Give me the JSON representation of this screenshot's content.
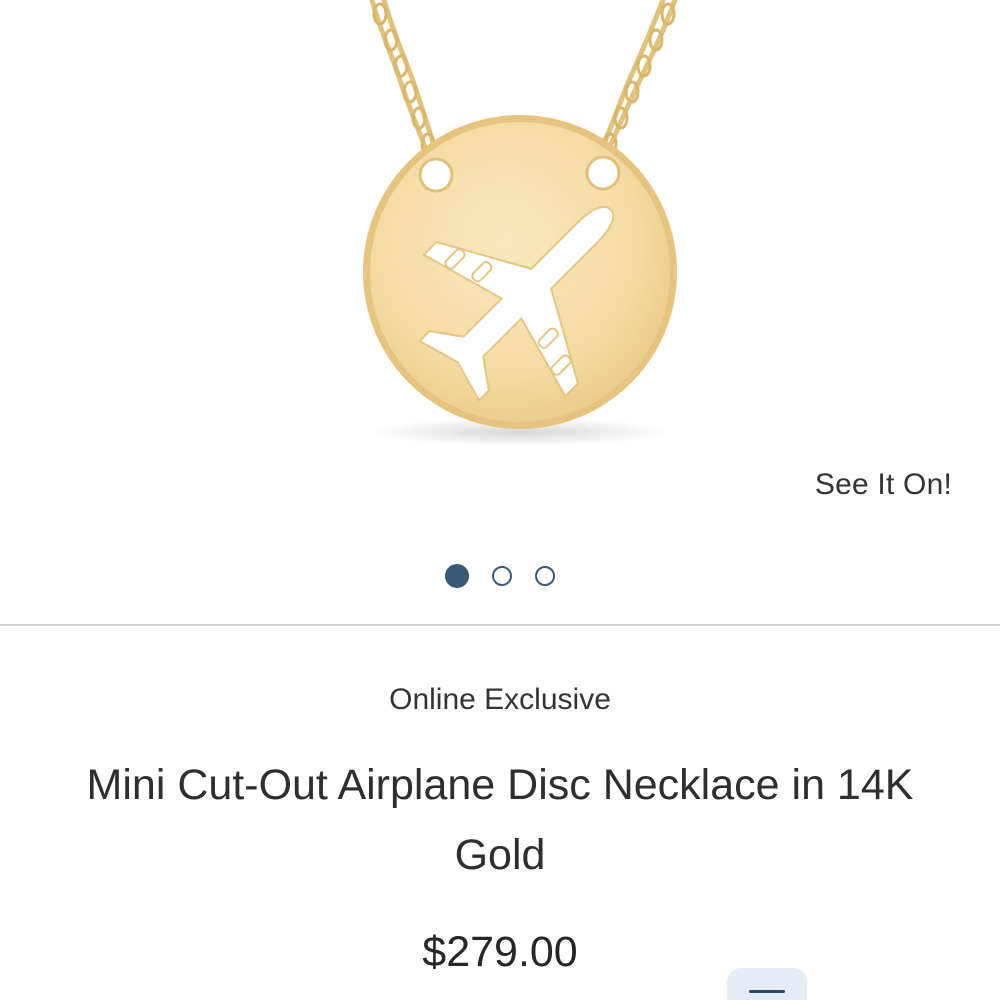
{
  "product": {
    "badge": "Online Exclusive",
    "title": "Mini Cut-Out Airplane Disc Necklace in 14K Gold",
    "price": "$279.00"
  },
  "gallery": {
    "see_it_on_label": "See It On!",
    "image_count": 3,
    "active_index": 1
  },
  "icons": {
    "floating_menu": "menu-icon"
  },
  "colors": {
    "accent": "#3a5b78",
    "gold": "#f0d59a",
    "divider": "#d6d6d6"
  }
}
